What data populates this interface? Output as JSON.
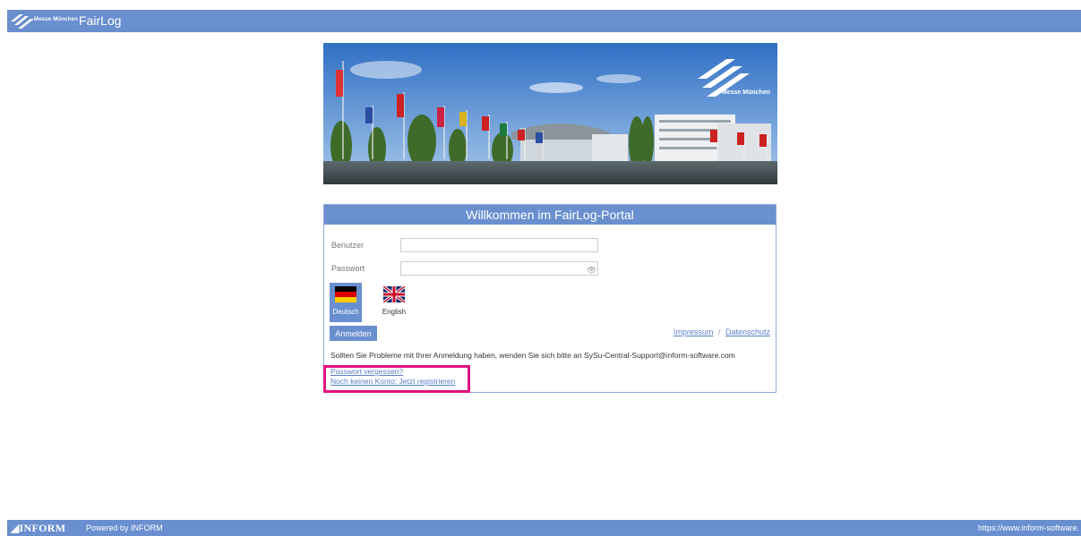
{
  "header": {
    "logo_text": "Messe München",
    "app_title": "FairLog"
  },
  "hero": {
    "brand_text": "Messe München"
  },
  "login": {
    "title": "Willkommen im FairLog-Portal",
    "user_label": "Benutzer",
    "user_value": "",
    "password_label": "Passwort",
    "password_value": "",
    "languages": [
      {
        "label": "Deutsch",
        "flag": "german-flag-icon",
        "active": true
      },
      {
        "label": "English",
        "flag": "uk-flag-icon",
        "active": false
      }
    ],
    "login_button": "Anmelden",
    "impressum": "Impressum",
    "separator": "/",
    "datenschutz": "Datenschutz",
    "help_text": "Sollten Sie Probleme mit Ihrer Anmeldung haben, wenden Sie sich bitte an SySu-Central-Support@inform-software.com",
    "forgot_password": "Passwort vergessen?",
    "register": "Noch keinen Konto: Jetzt registrieren"
  },
  "footer": {
    "logo_text": "INFORM",
    "powered": "Powered by INFORM",
    "url": "https://www.inform-software."
  },
  "colors": {
    "brand_blue": "#6a8fcf",
    "highlight": "#e0107e",
    "link": "#5b7fc7"
  }
}
